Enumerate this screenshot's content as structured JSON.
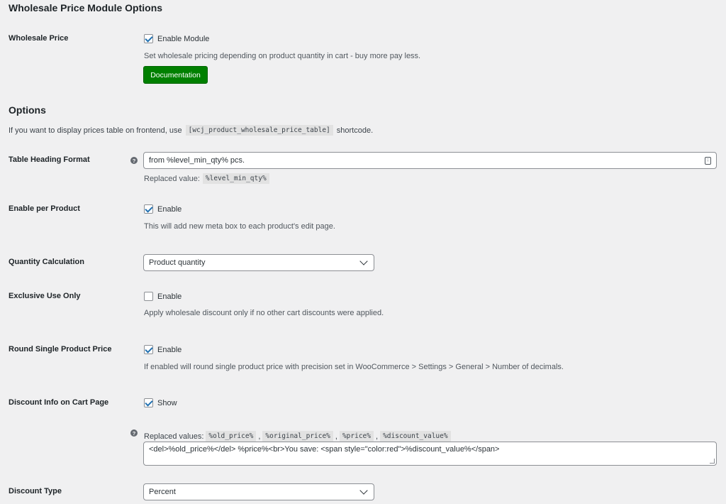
{
  "page": {
    "title": "Wholesale Price Module Options",
    "options_heading": "Options",
    "options_intro_before": "If you want to display prices table on frontend, use",
    "options_intro_code": "[wcj_product_wholesale_price_table]",
    "options_intro_after": "shortcode."
  },
  "wholesale_price": {
    "label": "Wholesale Price",
    "checkbox_label": "Enable Module",
    "checked": true,
    "description": "Set wholesale pricing depending on product quantity in cart - buy more pay less.",
    "doc_button": "Documentation"
  },
  "table_heading_format": {
    "label": "Table Heading Format",
    "value": "from %level_min_qty% pcs.",
    "replaced_label": "Replaced value:",
    "replaced_code": "%level_min_qty%"
  },
  "enable_per_product": {
    "label": "Enable per Product",
    "checkbox_label": "Enable",
    "checked": true,
    "description": "This will add new meta box to each product's edit page."
  },
  "quantity_calculation": {
    "label": "Quantity Calculation",
    "selected": "Product quantity"
  },
  "exclusive_use_only": {
    "label": "Exclusive Use Only",
    "checkbox_label": "Enable",
    "checked": false,
    "description": "Apply wholesale discount only if no other cart discounts were applied."
  },
  "round_single_product_price": {
    "label": "Round Single Product Price",
    "checkbox_label": "Enable",
    "checked": true,
    "description": "If enabled will round single product price with precision set in WooCommerce > Settings > General > Number of decimals."
  },
  "discount_info_cart": {
    "label": "Discount Info on Cart Page",
    "checkbox_label": "Show",
    "checked": true,
    "replaced_label": "Replaced values:",
    "codes": [
      "%old_price%",
      "%original_price%",
      "%price%",
      "%discount_value%"
    ],
    "separator": ",",
    "textarea_value": "<del>%old_price%</del> %price%<br>You save: <span style=\"color:red\">%discount_value%</span>"
  },
  "discount_type": {
    "label": "Discount Type",
    "selected": "Percent"
  },
  "icons": {
    "help": "question-circle-icon",
    "checkmark": "checkmark-icon",
    "chevron": "chevron-down-icon",
    "field_key": "password-manager-icon"
  },
  "colors": {
    "background": "#f0f0f1",
    "doc_button": "#008000",
    "checkmark": "#2271b1"
  }
}
